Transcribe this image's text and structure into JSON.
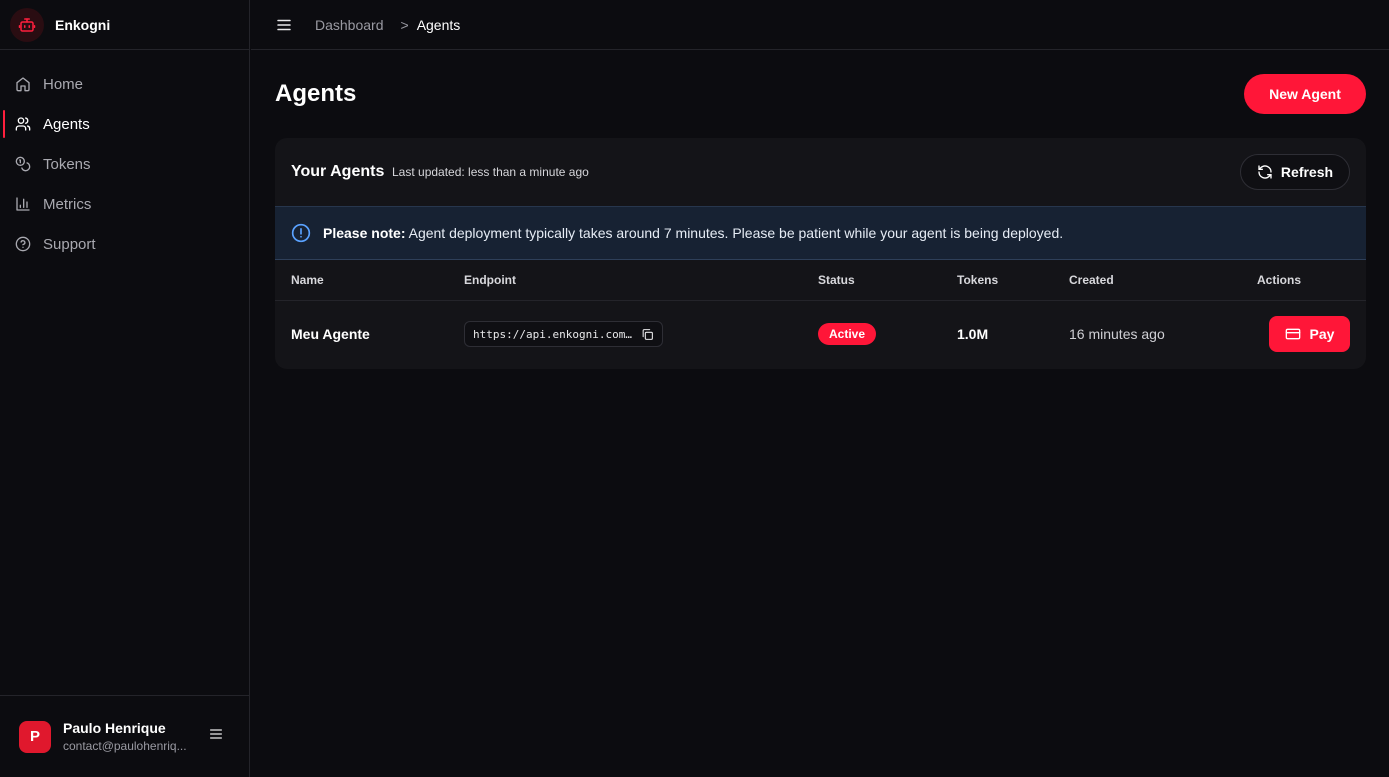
{
  "brand": {
    "name": "Enkogni",
    "logo_icon": "robot-icon",
    "accent": "#ff1638"
  },
  "sidebar": {
    "items": [
      {
        "label": "Home",
        "icon": "home-icon",
        "active": false
      },
      {
        "label": "Agents",
        "icon": "users-icon",
        "active": true
      },
      {
        "label": "Tokens",
        "icon": "coins-icon",
        "active": false
      },
      {
        "label": "Metrics",
        "icon": "bar-chart-icon",
        "active": false
      },
      {
        "label": "Support",
        "icon": "help-circle-icon",
        "active": false
      }
    ]
  },
  "user": {
    "initial": "P",
    "name": "Paulo Henrique",
    "email": "contact@paulohenriq..."
  },
  "topbar": {
    "breadcrumb": [
      "Dashboard",
      "Agents"
    ],
    "separator": ">"
  },
  "page": {
    "title": "Agents",
    "new_button": "New Agent"
  },
  "card": {
    "title": "Your Agents",
    "updated": "Last updated: less than a minute ago",
    "refresh_label": "Refresh",
    "notice_bold": "Please note:",
    "notice_text": " Agent deployment typically takes around 7 minutes. Please be patient while your agent is being deployed.",
    "columns": [
      "Name",
      "Endpoint",
      "Status",
      "Tokens",
      "Created",
      "Actions"
    ],
    "rows": [
      {
        "name": "Meu Agente",
        "endpoint": "https://api.enkogni.com…",
        "status": "Active",
        "tokens": "1.0M",
        "created": "16 minutes ago",
        "action": "Pay"
      }
    ]
  }
}
